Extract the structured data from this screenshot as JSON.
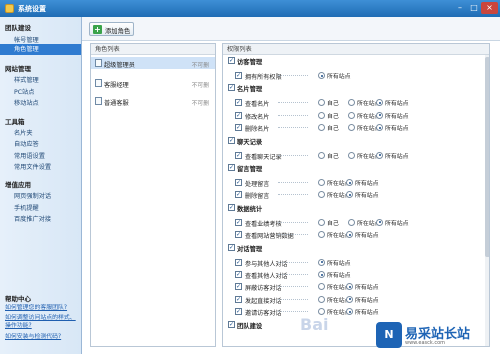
{
  "window": {
    "title": "系统设置",
    "min": "–",
    "max": "□",
    "close": "×"
  },
  "sidebar": {
    "groups": [
      {
        "label": "团队建设",
        "items": [
          {
            "label": "帐号管理"
          },
          {
            "label": "角色管理"
          }
        ]
      },
      {
        "label": "网站管理",
        "items": [
          {
            "label": "样式管理"
          },
          {
            "label": "PC站点"
          },
          {
            "label": "移动站点"
          }
        ]
      },
      {
        "label": "工具箱",
        "items": [
          {
            "label": "名片夹"
          },
          {
            "label": "自动应答"
          },
          {
            "label": "常用语设置"
          },
          {
            "label": "常用文件设置"
          }
        ]
      },
      {
        "label": "增值应用",
        "items": [
          {
            "label": "网页强制对话"
          },
          {
            "label": "手机提醒"
          },
          {
            "label": "百度推广对接"
          }
        ]
      }
    ],
    "active_item": "角色管理",
    "help_title": "帮助中心",
    "help_links": [
      "如何管理您的客服团队?",
      "如何调整访问站点的样式、操作功能?",
      "如何安装与检测代码?"
    ]
  },
  "toolbar": {
    "add_label": "添加角色"
  },
  "roles_panel": {
    "header": "角色列表",
    "roles": [
      {
        "name": "超级管理员",
        "status": "不可删",
        "selected": true
      },
      {
        "name": "客服经理",
        "status": "不可删",
        "selected": false
      },
      {
        "name": "普通客服",
        "status": "不可删",
        "selected": false
      }
    ]
  },
  "perms_panel": {
    "header": "权限列表",
    "categories": [
      {
        "name": "访客管理",
        "items": [
          {
            "name": "拥有所有权限",
            "options": [
              "所有站点"
            ],
            "selected": 0
          }
        ]
      },
      {
        "name": "名片管理",
        "items": [
          {
            "name": "查看名片",
            "options": [
              "自己",
              "所在站点",
              "所有站点"
            ],
            "selected": 2
          },
          {
            "name": "修改名片",
            "options": [
              "自己",
              "所在站点",
              "所有站点"
            ],
            "selected": 2
          },
          {
            "name": "删除名片",
            "options": [
              "自己",
              "所在站点",
              "所有站点"
            ],
            "selected": 2
          }
        ]
      },
      {
        "name": "聊天记录",
        "items": [
          {
            "name": "查看聊天记录",
            "options": [
              "自己",
              "所在站点",
              "所有站点"
            ],
            "selected": 2
          }
        ]
      },
      {
        "name": "留言管理",
        "items": [
          {
            "name": "处理留言",
            "options": [
              "所在站点",
              "所有站点"
            ],
            "selected": 1
          },
          {
            "name": "删除留言",
            "options": [
              "所在站点",
              "所有站点"
            ],
            "selected": 1
          }
        ]
      },
      {
        "name": "数据统计",
        "items": [
          {
            "name": "查看业绩考核",
            "options": [
              "自己",
              "所在站点",
              "所有站点"
            ],
            "selected": 2
          },
          {
            "name": "查看网站营销数据",
            "options": [
              "所在站点",
              "所有站点"
            ],
            "selected": 1
          }
        ]
      },
      {
        "name": "对话管理",
        "items": [
          {
            "name": "参与其他人对话",
            "options": [
              "所有站点"
            ],
            "selected": 0
          },
          {
            "name": "查看其他人对话",
            "options": [
              "所有站点"
            ],
            "selected": 0
          },
          {
            "name": "屏蔽访客对话",
            "options": [
              "所在站点",
              "所有站点"
            ],
            "selected": 1
          },
          {
            "name": "发起直接对话",
            "options": [
              "所在站点",
              "所有站点"
            ],
            "selected": 1
          },
          {
            "name": "邀请访客对话",
            "options": [
              "所在站点",
              "所有站点"
            ],
            "selected": 1
          }
        ]
      },
      {
        "name": "团队建设",
        "items": []
      }
    ]
  },
  "watermark": {
    "logo": "N",
    "text": "易采站长站",
    "sub": "www.easck.com",
    "bai": "Bai"
  }
}
